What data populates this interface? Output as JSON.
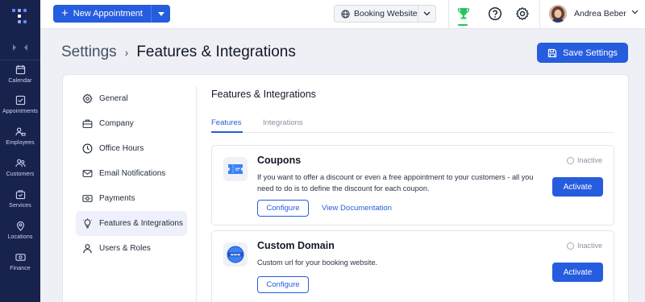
{
  "nav": {
    "items": [
      {
        "label": "Calendar",
        "icon": "calendar-icon"
      },
      {
        "label": "Appointments",
        "icon": "appointments-icon"
      },
      {
        "label": "Employees",
        "icon": "employees-icon"
      },
      {
        "label": "Customers",
        "icon": "customers-icon"
      },
      {
        "label": "Services",
        "icon": "services-icon"
      },
      {
        "label": "Locations",
        "icon": "location-pin-icon"
      },
      {
        "label": "Finance",
        "icon": "finance-icon"
      }
    ]
  },
  "topbar": {
    "new_appointment_label": "New Appointment",
    "booking_website_label": "Booking Website",
    "user_name": "Andrea Beber"
  },
  "header": {
    "breadcrumb_parent": "Settings",
    "breadcrumb_current": "Features & Integrations",
    "save_label": "Save Settings"
  },
  "settings_menu": {
    "items": [
      {
        "label": "General",
        "icon": "gear-outline-icon",
        "active": false
      },
      {
        "label": "Company",
        "icon": "briefcase-icon",
        "active": false
      },
      {
        "label": "Office Hours",
        "icon": "clock-icon",
        "active": false
      },
      {
        "label": "Email Notifications",
        "icon": "envelope-icon",
        "active": false
      },
      {
        "label": "Payments",
        "icon": "banknote-icon",
        "active": false
      },
      {
        "label": "Features & Integrations",
        "icon": "lightbulb-icon",
        "active": true
      },
      {
        "label": "Users & Roles",
        "icon": "user-icon",
        "active": false
      }
    ]
  },
  "panel": {
    "title": "Features & Integrations",
    "tabs": [
      {
        "label": "Features",
        "active": true
      },
      {
        "label": "Integrations",
        "active": false
      }
    ]
  },
  "features": [
    {
      "name": "Coupons",
      "description": "If you want to offer a discount or even a free appointment to your customers - all you need to do is to define the discount for each coupon.",
      "status": "Inactive",
      "activate_label": "Activate",
      "configure_label": "Configure",
      "doc_label": "View Documentation",
      "icon": "coupon-ticket-icon"
    },
    {
      "name": "Custom Domain",
      "description": "Custom url for your booking website.",
      "status": "Inactive",
      "activate_label": "Activate",
      "configure_label": "Configure",
      "icon": "www-globe-icon"
    }
  ],
  "colors": {
    "accent": "#265cde",
    "nav_bg": "#17224d",
    "page_bg": "#eef0f5",
    "success": "#22c55e"
  }
}
